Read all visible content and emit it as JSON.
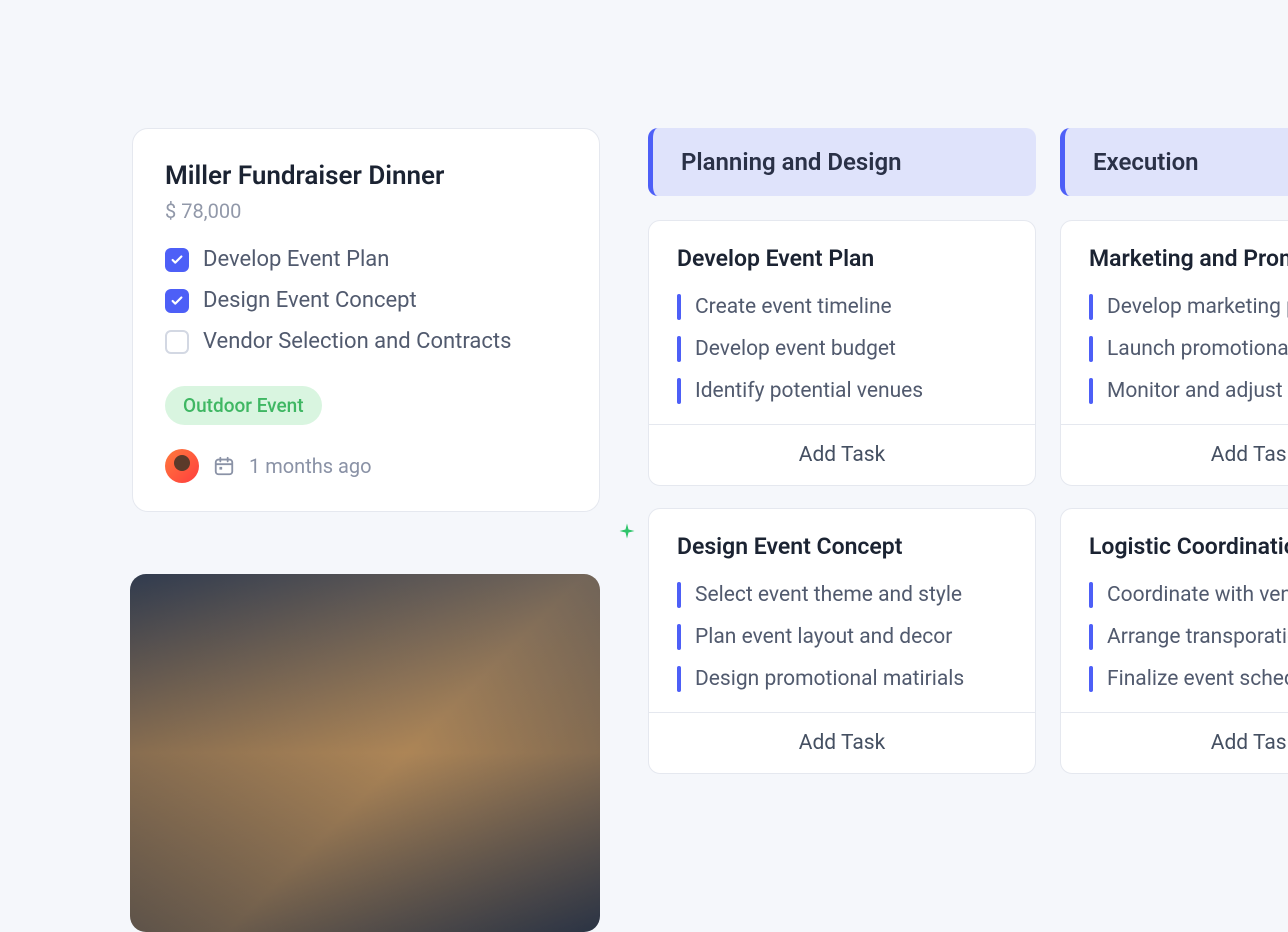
{
  "event": {
    "title": "Miller Fundraiser Dinner",
    "budget": "$ 78,000",
    "checklist": [
      {
        "label": "Develop Event Plan",
        "checked": true
      },
      {
        "label": "Design Event Concept",
        "checked": true
      },
      {
        "label": "Vendor Selection and Contracts",
        "checked": false
      }
    ],
    "tag": "Outdoor Event",
    "timestamp": "1 months ago"
  },
  "columns": [
    {
      "title": "Planning and Design",
      "cards": [
        {
          "title": "Develop Event Plan",
          "subtasks": [
            "Create event timeline",
            "Develop event budget",
            "Identify potential venues"
          ],
          "add_label": "Add Task"
        },
        {
          "title": "Design Event Concept",
          "subtasks": [
            "Select event theme and style",
            "Plan event layout and decor",
            "Design promotional matirials"
          ],
          "add_label": "Add Task"
        }
      ]
    },
    {
      "title": "Execution",
      "cards": [
        {
          "title": "Marketing and Promotion",
          "subtasks": [
            "Develop marketing plan",
            "Launch promotional campaigns",
            "Monitor and adjust strategy"
          ],
          "add_label": "Add Task"
        },
        {
          "title": "Logistic Coordination",
          "subtasks": [
            "Coordinate with vendors",
            "Arrange transporation",
            "Finalize event schedule"
          ],
          "add_label": "Add Task"
        }
      ]
    }
  ]
}
